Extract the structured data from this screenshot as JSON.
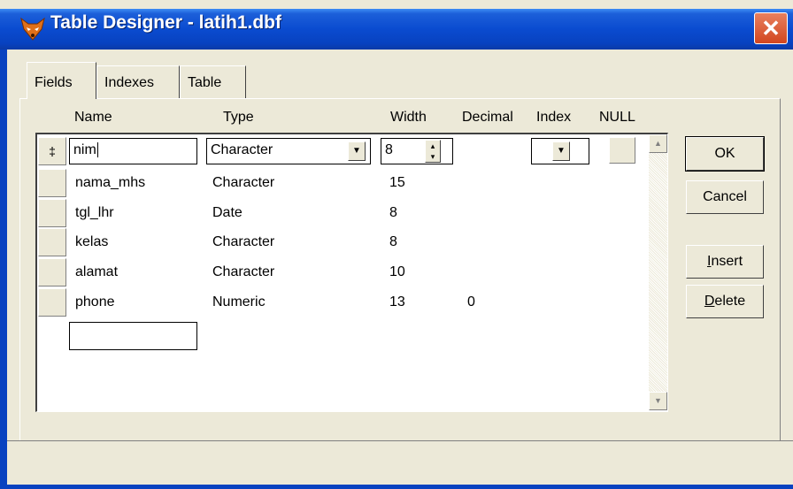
{
  "window": {
    "title": "Table Designer - latih1.dbf",
    "close_glyph": "✕",
    "app_icon": "fox-icon",
    "colors": {
      "titlebar": "#0842c0",
      "face": "#ece9d8",
      "close": "#d2461f"
    }
  },
  "tabs": [
    {
      "label": "Fields",
      "active": true
    },
    {
      "label": "Indexes",
      "active": false
    },
    {
      "label": "Table",
      "active": false
    }
  ],
  "columns": {
    "name": "Name",
    "type": "Type",
    "width": "Width",
    "decimal": "Decimal",
    "index": "Index",
    "null": "NULL"
  },
  "rows": [
    {
      "marker": "‡",
      "name": "nim",
      "type": "Character",
      "width": "8",
      "decimal": ""
    },
    {
      "marker": "",
      "name": "nama_mhs",
      "type": "Character",
      "width": "15",
      "decimal": ""
    },
    {
      "marker": "",
      "name": "tgl_lhr",
      "type": "Date",
      "width": "8",
      "decimal": ""
    },
    {
      "marker": "",
      "name": "kelas",
      "type": "Character",
      "width": "8",
      "decimal": ""
    },
    {
      "marker": "",
      "name": "alamat",
      "type": "Character",
      "width": "10",
      "decimal": ""
    },
    {
      "marker": "",
      "name": "phone",
      "type": "Numeric",
      "width": "13",
      "decimal": "0"
    }
  ],
  "new_row": {
    "name": ""
  },
  "buttons": {
    "ok": "OK",
    "cancel": "Cancel",
    "insert": "Insert",
    "delete": "Delete"
  }
}
